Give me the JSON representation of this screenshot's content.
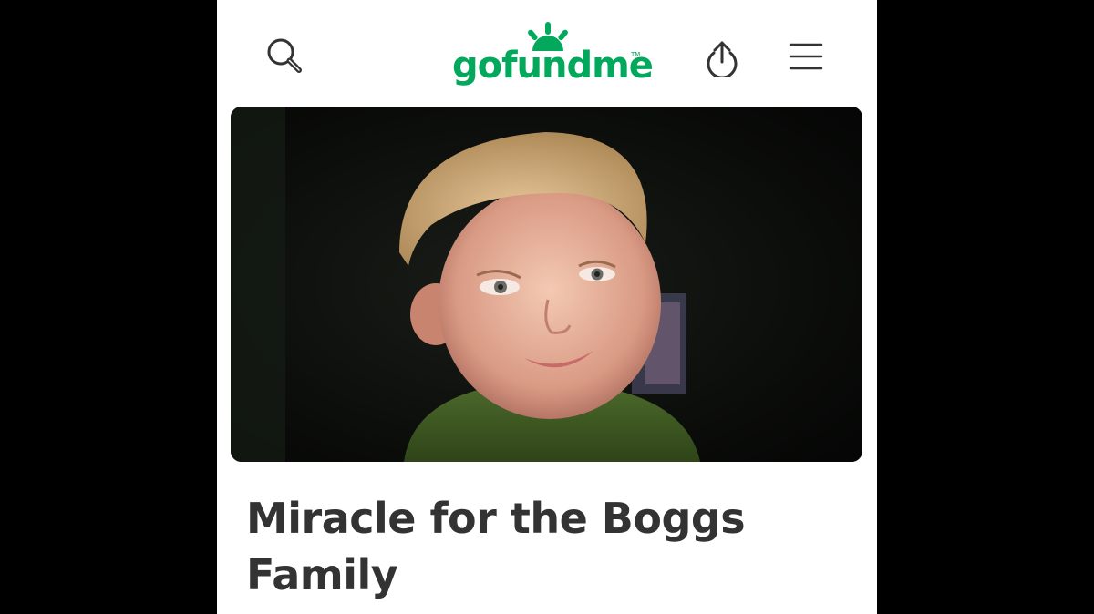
{
  "header": {
    "logo_text": "gofundme",
    "logo_tm": "TM",
    "brand_color": "#02a95c",
    "icons": [
      "search-icon",
      "share-icon",
      "menu-icon"
    ]
  },
  "hero": {
    "image_description_icon": "photo-of-child"
  },
  "campaign": {
    "title": "Miracle for the Boggs Family"
  },
  "colors": {
    "background_outer": "#000000",
    "page_background": "#ffffff",
    "title_text": "#333333"
  }
}
